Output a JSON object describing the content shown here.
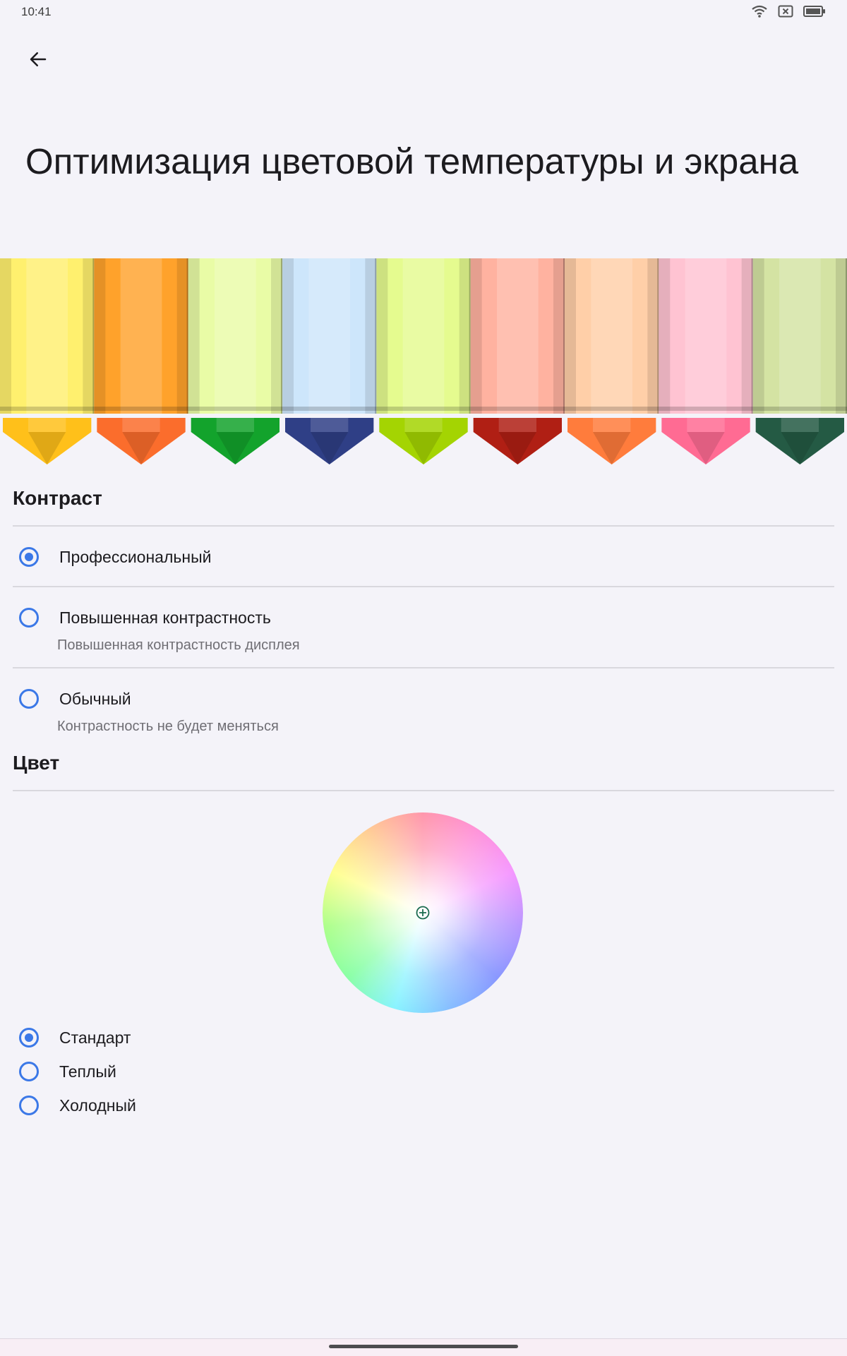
{
  "status_bar": {
    "time": "10:41",
    "icons": [
      "wifi-icon",
      "sim-off-icon",
      "battery-icon"
    ]
  },
  "header": {
    "back_icon": "arrow-left-icon",
    "title": "Оптимизация цветовой температуры и экрана"
  },
  "banner": {
    "crayon_colors": [
      "#fff06e",
      "#ffa22b",
      "#e9fca6",
      "#cde6fb",
      "#e5fb8f",
      "#ffb2a0",
      "#ffcfa8",
      "#ffc3d2",
      "#d4e3a3"
    ],
    "crayon_tips": [
      "#ffc01a",
      "#fb6d2c",
      "#13a32c",
      "#2f3f86",
      "#a4d402",
      "#b01f14",
      "#ff7c3c",
      "#ff6b93",
      "#245a44"
    ]
  },
  "contrast": {
    "section_title": "Контраст",
    "options": [
      {
        "label": "Профессиональный",
        "sublabel": "",
        "selected": true
      },
      {
        "label": "Повышенная контрастность",
        "sublabel": "Повышенная контрастность дисплея",
        "selected": false
      },
      {
        "label": "Обычный",
        "sublabel": "Контрастность не будет меняться",
        "selected": false
      }
    ]
  },
  "color": {
    "section_title": "Цвет",
    "wheel_marker_icon": "crosshair-plus-icon",
    "options": [
      {
        "label": "Стандарт",
        "selected": true
      },
      {
        "label": "Теплый",
        "selected": false
      },
      {
        "label": "Холодный",
        "selected": false
      }
    ]
  },
  "theme": {
    "accent": "#3b78e7",
    "background": "#f4f3f9"
  }
}
